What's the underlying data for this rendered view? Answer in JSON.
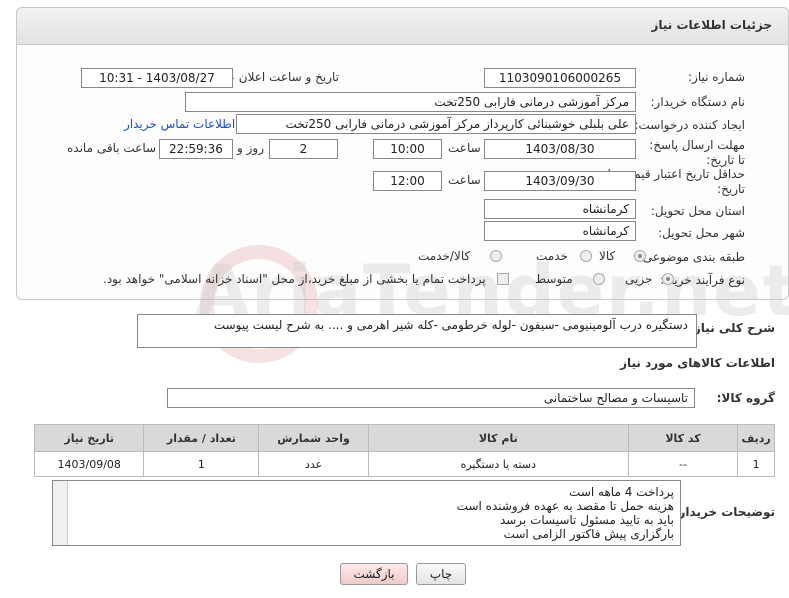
{
  "panel": {
    "title": "جزئیات اطلاعات نیاز"
  },
  "fields": {
    "need_number_label": "شماره نیاز:",
    "need_number": "1103090106000265",
    "announce_label": "تاریخ و ساعت اعلان عمومی:",
    "announce_value": "1403/08/27 - 10:31",
    "buyer_label": "نام دستگاه خریدار:",
    "buyer_value": "مرکز آموزشی  درمانی فارابی 250تخت",
    "creator_label": "ایجاد کننده درخواست:",
    "creator_value": "علی بلبلی خوشبنائی کارپرداز مرکز آموزشی  درمانی فارابی 250تخت",
    "contact_link": "اطلاعات تماس خریدار",
    "deadline_label": "مهلت ارسال پاسخ: تا تاریخ:",
    "deadline_date": "1403/08/30",
    "time_label": "ساعت",
    "deadline_time": "10:00",
    "days_value": "2",
    "days_label": "روز و",
    "remaining_time": "22:59:36",
    "remaining_label": "ساعت باقی مانده",
    "validity_label": "حداقل تاریخ اعتبار قیمت: تا تاریخ:",
    "validity_date": "1403/09/30",
    "validity_time": "12:00",
    "province_label": "استان محل تحویل:",
    "province_value": "کرمانشاه",
    "city_label": "شهر محل تحویل:",
    "city_value": "کرمانشاه",
    "category_label": "طبقه بندی موضوعی:",
    "category_options": [
      "کالا",
      "خدمت",
      "کالا/خدمت"
    ],
    "process_label": "نوع فرآیند خرید :",
    "process_options": [
      "جزیی",
      "متوسط"
    ],
    "payment_note": "پرداخت تمام یا بخشی از مبلغ خرید،از محل \"اسناد خزانه اسلامی\" خواهد بود."
  },
  "description": {
    "label": "شرح کلی نیاز:",
    "value": "دستگیره درب آلومینیومی -سیفون -لوله خرطومی -کله شیر اهرمی و .... به شرح لیست پیوست"
  },
  "goods_section": {
    "title": "اطلاعات کالاهای مورد نیاز"
  },
  "goods_group": {
    "label": "گروه کالا:",
    "value": "تاسیسات و مصالح ساختمانی"
  },
  "table": {
    "headers": [
      "ردیف",
      "کد کالا",
      "نام کالا",
      "واحد شمارش",
      "تعداد / مقدار",
      "تاریخ نیاز"
    ],
    "rows": [
      [
        "1",
        "--",
        "دسته یا دستگیره",
        "عدد",
        "1",
        "1403/09/08"
      ]
    ]
  },
  "buyer_notes": {
    "label": "توضیحات خریدار:",
    "lines": [
      "پرداخت 4 ماهه است",
      "هزینه حمل تا مقصد به عهده فروشنده است",
      "باید به تایید مسئول تاسیسات برسد",
      "بارگزاری پیش فاکتور الزامی است"
    ]
  },
  "buttons": {
    "print": "چاپ",
    "back": "بازگشت"
  }
}
